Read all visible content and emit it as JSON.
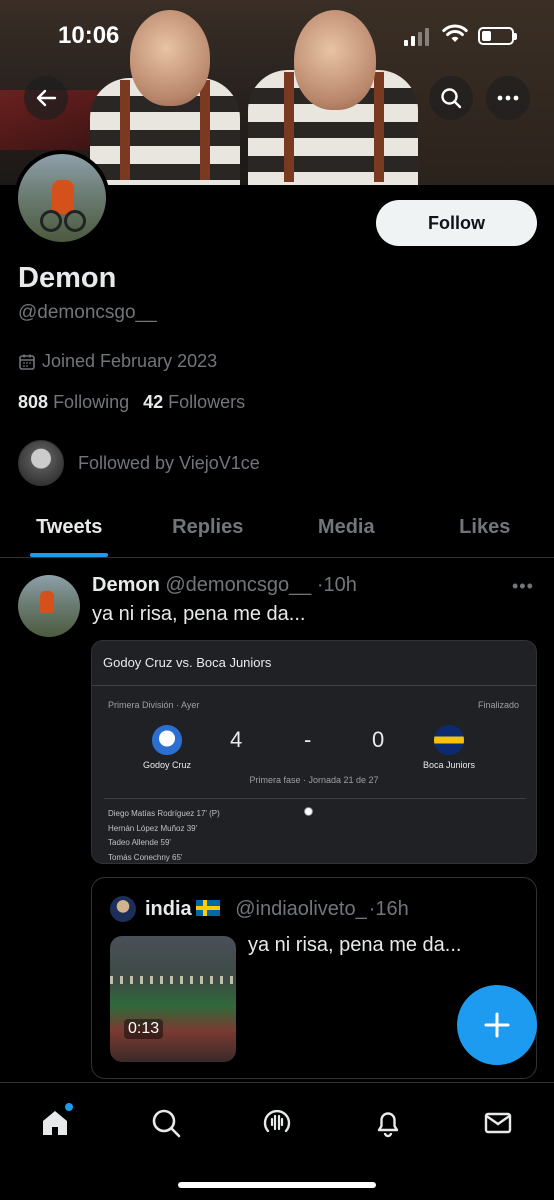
{
  "status_bar": {
    "time": "10:06"
  },
  "profile": {
    "name": "Demon",
    "handle": "@demoncsgo__",
    "joined": "Joined February 2023",
    "following_count": "808",
    "following_label": "Following",
    "followers_count": "42",
    "followers_label": "Followers",
    "followed_by": "Followed by ViejoV1ce",
    "follow_button": "Follow"
  },
  "tabs": [
    {
      "label": "Tweets",
      "active": true
    },
    {
      "label": "Replies",
      "active": false
    },
    {
      "label": "Media",
      "active": false
    },
    {
      "label": "Likes",
      "active": false
    }
  ],
  "tweet": {
    "name": "Demon",
    "handle": "@demoncsgo__",
    "time": "·10h",
    "text": "ya ni risa, pena me da...",
    "match_card": {
      "title": "Godoy Cruz vs. Boca Juniors",
      "league": "Primera División · Ayer",
      "status": "Finalizado",
      "home_team": "Godoy Cruz",
      "away_team": "Boca Juniors",
      "home_score": "4",
      "separator": "-",
      "away_score": "0",
      "phase": "Primera fase · Jornada 21 de 27",
      "scorers": [
        "Diego Matías Rodríguez 17' (P)",
        "Hernán López Muñoz 39'",
        "Tadeo Allende 59'",
        "Tomás Conechny 65'"
      ]
    },
    "quote": {
      "name": "india",
      "handle": "@indiaoliveto_",
      "time": "·16h",
      "text": "ya ni risa, pena me da...",
      "video_duration": "0:13"
    }
  },
  "colors": {
    "accent": "#1d9bf0",
    "background": "#000000",
    "text_primary": "#e7e9ea",
    "text_secondary": "#71767b",
    "divider": "#2f3336"
  },
  "nav": [
    "home-icon",
    "search-icon",
    "spaces-icon",
    "notifications-icon",
    "messages-icon"
  ]
}
